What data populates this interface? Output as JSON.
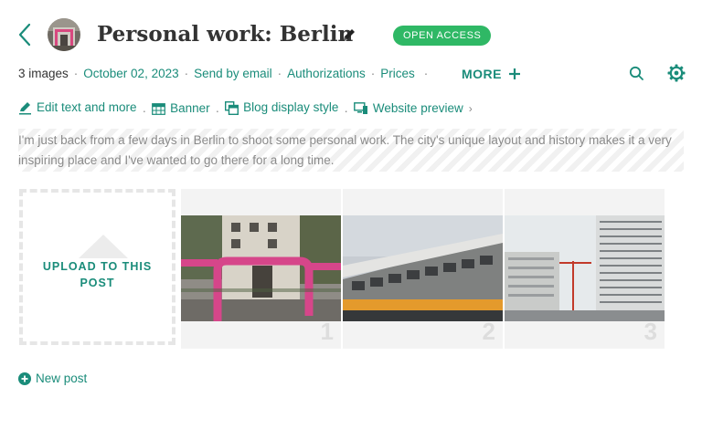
{
  "header": {
    "title": "Personal work: Berlin",
    "badge": "OPEN ACCESS",
    "accent_color": "#1a8c7a",
    "badge_color": "#2fb865"
  },
  "meta": {
    "image_count": "3 images",
    "date": "October 02, 2023",
    "links": [
      "Send by email",
      "Authorizations",
      "Prices"
    ],
    "more_label": "MORE"
  },
  "actions": [
    {
      "label": "Edit text and more",
      "icon": "edit-icon"
    },
    {
      "label": "Banner",
      "icon": "banner-icon"
    },
    {
      "label": "Blog display style",
      "icon": "layout-icon"
    },
    {
      "label": "Website preview",
      "icon": "monitor-icon"
    }
  ],
  "description": "I'm just back from a few days in Berlin to shoot some personal work. The city's unique layout and history makes it a very inspiring place and I've wanted to go there for a long time.",
  "gallery": {
    "upload_label": "UPLOAD TO THIS POST",
    "images": [
      {
        "number": "1",
        "subject": "pink pipe arch in courtyard"
      },
      {
        "number": "2",
        "subject": "modern building facade with train"
      },
      {
        "number": "3",
        "subject": "office towers with crane"
      }
    ]
  },
  "footer": {
    "new_post_label": "New post"
  }
}
